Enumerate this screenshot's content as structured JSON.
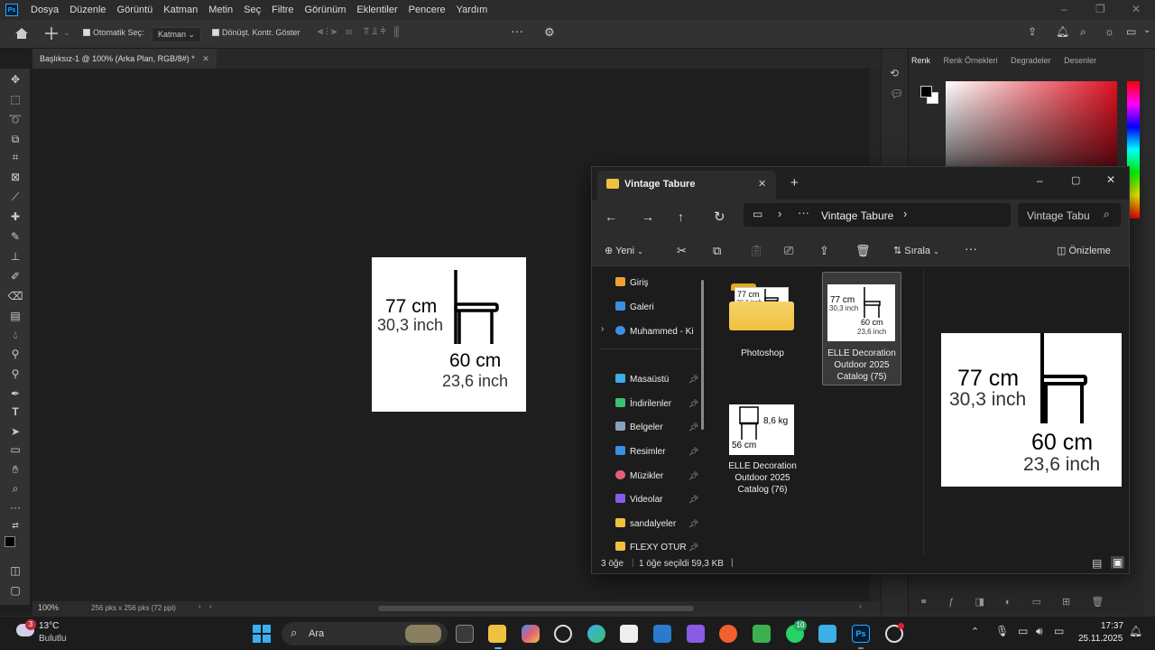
{
  "menubar": {
    "logo": "Ps",
    "items": [
      "Dosya",
      "Düzenle",
      "Görüntü",
      "Katman",
      "Metin",
      "Seç",
      "Filtre",
      "Görünüm",
      "Eklentiler",
      "Pencere",
      "Yardım"
    ]
  },
  "options": {
    "auto_select_label": "Otomatik Seç:",
    "auto_select_value": "Katman",
    "transform_controls_label": "Dönüşt. Kontr. Göster"
  },
  "document": {
    "tab_title": "Başlıksız-1 @ 100% (Arka Plan, RGB/8#) *",
    "height_cm": "77 cm",
    "height_inch": "30,3 inch",
    "width_cm": "60 cm",
    "width_inch": "23,6 inch"
  },
  "statusbar": {
    "zoom": "100%",
    "doc_info": "256 pks x 256 pks (72 ppi)"
  },
  "panels": {
    "tabs": [
      "Renk",
      "Renk Örnekleri",
      "Degradeler",
      "Desenler"
    ],
    "accent": "#e01020"
  },
  "explorer": {
    "tab_title": "Vintage Tabure",
    "breadcrumb": "Vintage Tabure",
    "search_placeholder": "Vintage Tabu",
    "new_label": "Yeni",
    "sort_label": "Sırala",
    "preview_label": "Önizleme",
    "sidebar": [
      {
        "label": "Giriş",
        "color": "#f0a030"
      },
      {
        "label": "Galeri",
        "color": "#3a8ee6"
      },
      {
        "label": "Muhammed - Ki",
        "color": "#3a8ee6"
      },
      {
        "label": "Masaüstü",
        "color": "#3ab0e6"
      },
      {
        "label": "İndirilenler",
        "color": "#3cc070"
      },
      {
        "label": "Belgeler",
        "color": "#8aa0c0"
      },
      {
        "label": "Resimler",
        "color": "#3a8ee6"
      },
      {
        "label": "Müzikler",
        "color": "#e0607a"
      },
      {
        "label": "Videolar",
        "color": "#8a5ae6"
      },
      {
        "label": "sandalyeler",
        "color": "#f0c040"
      },
      {
        "label": "FLEXY OTURM",
        "color": "#f0c040"
      }
    ],
    "files": [
      {
        "name": "Photoshop"
      },
      {
        "name_lines": [
          "ELLE Decoration",
          "Outdoor 2025",
          "Catalog  (75)"
        ]
      },
      {
        "name_lines": [
          "ELLE Decoration",
          "Outdoor 2025",
          "Catalog  (76)"
        ]
      }
    ],
    "thumb2": {
      "weight": "8,6 kg",
      "width": "56 cm"
    },
    "status": {
      "count": "3 öğe",
      "selected": "1 öğe seçildi  59,3 KB"
    }
  },
  "taskbar": {
    "weather_temp": "13°C",
    "weather_desc": "Bulutlu",
    "weather_badge": "3",
    "search_label": "Ara",
    "whatsapp_badge": "10",
    "time": "17:37",
    "date": "25.11.2025"
  }
}
